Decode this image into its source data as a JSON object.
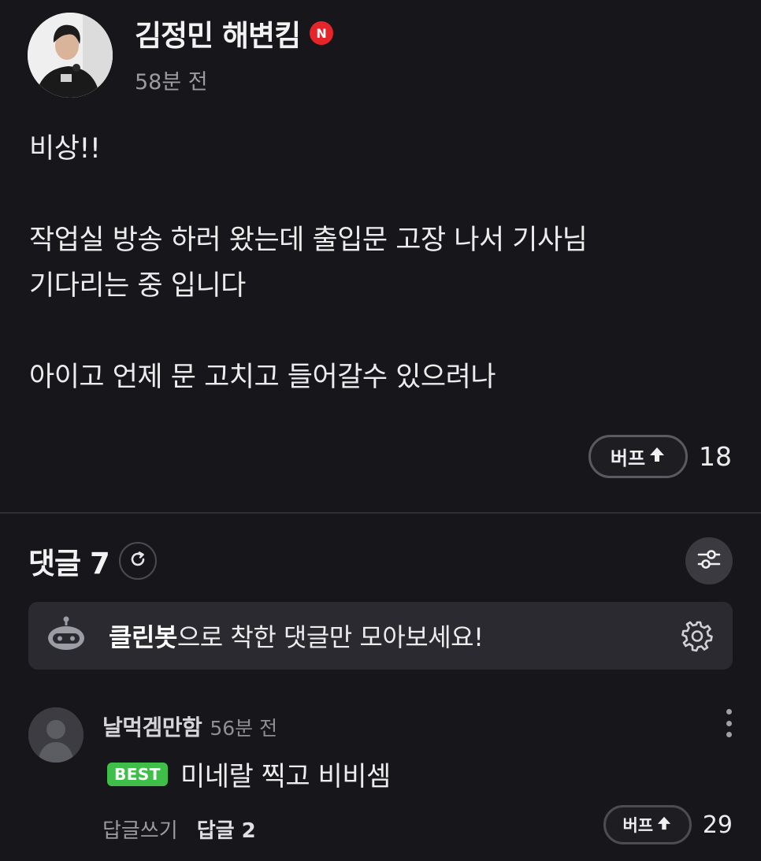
{
  "post": {
    "author": "김정민 해변킴",
    "author_badge": "N",
    "time": "58분 전",
    "body_lines": [
      "비상!!",
      "",
      "작업실 방송 하러 왔는데 출입문 고장 나서 기사님",
      "기다리는 중 입니다",
      "",
      "아이고 언제 문 고치고 들어갈수 있으려나"
    ],
    "buff_label": "버프",
    "buff_count": "18"
  },
  "comments_section": {
    "title": "댓글",
    "count": "7",
    "cleanbot": {
      "bold": "클린봇",
      "text": "으로 착한 댓글만 모아보세요!"
    }
  },
  "comment": {
    "author": "날먹겜만함",
    "time": "56분 전",
    "badge": "BEST",
    "text": "미네랄 찍고 비비셈",
    "reply_write": "답글쓰기",
    "reply_count": "답글 2",
    "buff_label": "버프",
    "buff_count": "29"
  },
  "colors": {
    "background": "#17171b",
    "badge_n": "#e5252a",
    "best": "#3fbf4a",
    "banner": "#2a2a30"
  },
  "icons": [
    "refresh-icon",
    "filter-sliders-icon",
    "cleanbot-robot-icon",
    "settings-gear-icon",
    "more-vertical-icon",
    "arrow-up-icon"
  ]
}
